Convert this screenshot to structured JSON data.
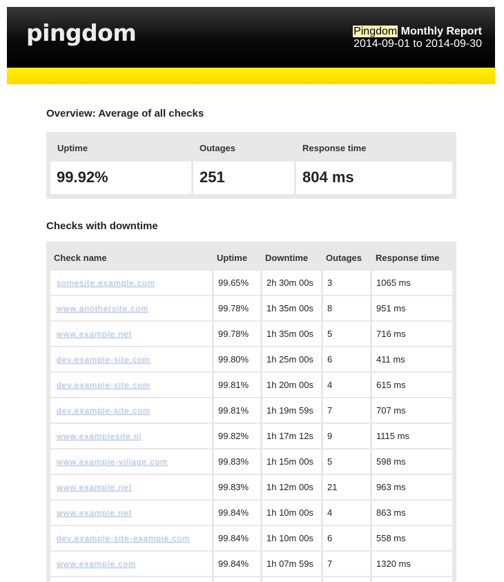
{
  "header": {
    "logo": "pingdom",
    "brand": "Pingdom",
    "title_rest": "Monthly Report",
    "dates": "2014-09-01 to 2014-09-30"
  },
  "overview": {
    "title": "Overview: Average of all checks",
    "uptime_label": "Uptime",
    "outages_label": "Outages",
    "response_label": "Response time",
    "uptime": "99.92%",
    "outages": "251",
    "response": "804 ms"
  },
  "checks": {
    "title": "Checks with downtime",
    "columns": [
      "Check name",
      "Uptime",
      "Downtime",
      "Outages",
      "Response time"
    ],
    "rows": [
      {
        "name": "somesite.example.com",
        "uptime": "99.65%",
        "downtime": "2h 30m 00s",
        "outages": "3",
        "response": "1065 ms"
      },
      {
        "name": "www.anothersite.com",
        "uptime": "99.78%",
        "downtime": "1h 35m 00s",
        "outages": "8",
        "response": "951 ms"
      },
      {
        "name": "www.example.net",
        "uptime": "99.78%",
        "downtime": "1h 35m 00s",
        "outages": "5",
        "response": "716 ms"
      },
      {
        "name": "dev.example-site.com",
        "uptime": "99.80%",
        "downtime": "1h 25m 00s",
        "outages": "6",
        "response": "411 ms"
      },
      {
        "name": "dev.example-site.com",
        "uptime": "99.81%",
        "downtime": "1h 20m 00s",
        "outages": "4",
        "response": "615 ms"
      },
      {
        "name": "dev.example-site.com",
        "uptime": "99.81%",
        "downtime": "1h 19m 59s",
        "outages": "7",
        "response": "707 ms"
      },
      {
        "name": "www.examplesite.nl",
        "uptime": "99.82%",
        "downtime": "1h 17m 12s",
        "outages": "9",
        "response": "1115 ms"
      },
      {
        "name": "www.example-village.com",
        "uptime": "99.83%",
        "downtime": "1h 15m 00s",
        "outages": "5",
        "response": "598 ms"
      },
      {
        "name": "www.example.net",
        "uptime": "99.83%",
        "downtime": "1h 12m 00s",
        "outages": "21",
        "response": "963 ms"
      },
      {
        "name": "www.example.net",
        "uptime": "99.84%",
        "downtime": "1h 10m 00s",
        "outages": "4",
        "response": "863 ms"
      },
      {
        "name": "dev.example-site-example.com",
        "uptime": "99.84%",
        "downtime": "1h 10m 00s",
        "outages": "6",
        "response": "558 ms"
      },
      {
        "name": "www.example.com",
        "uptime": "99.84%",
        "downtime": "1h 07m 59s",
        "outages": "7",
        "response": "1320 ms"
      },
      {
        "name": "",
        "uptime": "",
        "downtime": "",
        "outages": "",
        "response": ""
      }
    ]
  }
}
